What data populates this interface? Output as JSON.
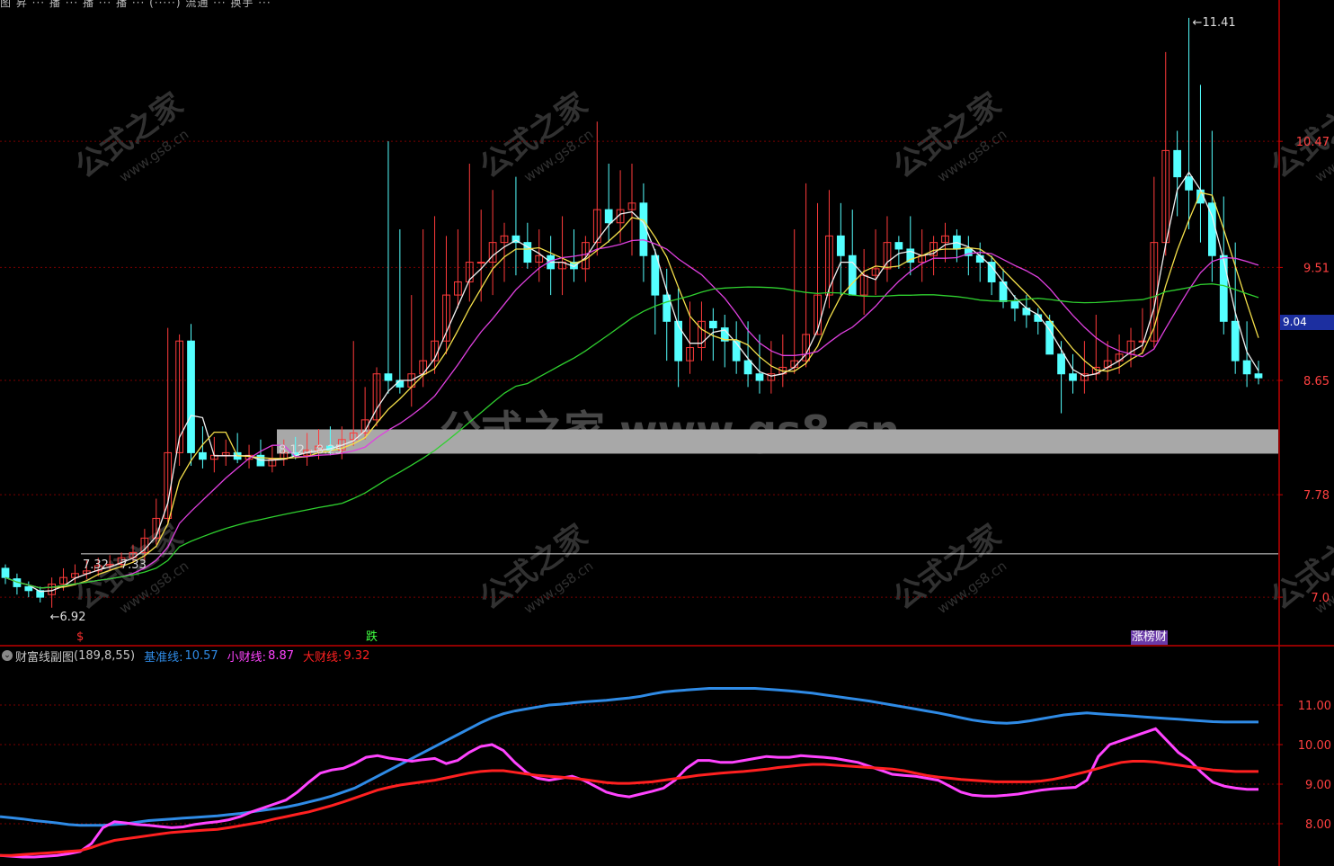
{
  "colors": {
    "background": "#000000",
    "up_candle": "#ff3b3b",
    "down_candle": "#54ffff",
    "ma_white": "#f0f0f0",
    "ma_yellow": "#f5e04a",
    "ma_magenta": "#e040e0",
    "ma_green": "#2fd02f",
    "grid": "#7a0000",
    "support_band": "#a8a8a8",
    "watermark": "#5a5a5a"
  },
  "watermarks": {
    "small": "公式之家",
    "small_url": "www.gs8.cn",
    "center": "公式之家 www.gs8.cn"
  },
  "price_panel": {
    "top_strip": "图 昇 ··· 播 ··· 播 ··· 播 ··· (·····) 流通 ··· 换手 ···",
    "y_axis_ticks": [
      "10.47",
      "9.51",
      "8.65",
      "7.78",
      "7.0"
    ],
    "current_price_tag": "9.04",
    "annotations": {
      "high": "11.41",
      "low": "6.92",
      "band_upper": "8.12 - 8.25",
      "band_lower": "7.32 - 7.33"
    },
    "signals": [
      {
        "text": "$",
        "color": "#ff3030"
      },
      {
        "text": "跌",
        "color": "#40ff40"
      },
      {
        "text": "涨榜财",
        "color": "#ffffff",
        "bg": "#6a3aa8"
      }
    ]
  },
  "indicator_panel": {
    "name": "财富线副图",
    "params": "(189,8,55)",
    "legend": [
      {
        "key": "基准线:",
        "value": "10.57",
        "color": "#2f8be6"
      },
      {
        "key": "小财线:",
        "value": "8.87",
        "color": "#ff44ff"
      },
      {
        "key": "大财线:",
        "value": "9.32",
        "color": "#ff2020"
      }
    ],
    "y_axis_ticks": [
      "11.00",
      "10.00",
      "9.00",
      "8.00"
    ]
  },
  "chart_data": [
    {
      "type": "candlestick",
      "ylim": [
        6.85,
        11.45
      ],
      "ohlc_open": [
        7.22,
        7.14,
        7.08,
        7.05,
        7.02,
        7.1,
        7.15,
        7.18,
        7.2,
        7.24,
        7.25,
        7.3,
        7.34,
        7.45,
        7.6,
        8.1,
        8.95,
        8.1,
        8.05,
        8.08,
        8.1,
        8.05,
        8.08,
        8.0,
        8.05,
        8.1,
        8.08,
        8.12,
        8.15,
        8.12,
        8.2,
        8.25,
        8.35,
        8.7,
        8.65,
        8.6,
        8.7,
        8.8,
        8.95,
        9.3,
        9.4,
        9.55,
        9.55,
        9.7,
        9.75,
        9.7,
        9.55,
        9.6,
        9.5,
        9.55,
        9.5,
        9.7,
        9.95,
        9.85,
        9.95,
        10.0,
        9.6,
        9.3,
        9.1,
        8.8,
        8.9,
        9.1,
        9.05,
        8.95,
        8.8,
        8.7,
        8.65,
        8.7,
        8.75,
        8.8,
        9.0,
        9.3,
        9.75,
        9.6,
        9.3,
        9.45,
        9.5,
        9.7,
        9.65,
        9.55,
        9.6,
        9.7,
        9.75,
        9.65,
        9.6,
        9.55,
        9.4,
        9.25,
        9.2,
        9.15,
        9.1,
        8.85,
        8.7,
        8.65,
        8.7,
        8.75,
        8.8,
        8.85,
        8.95,
        8.95,
        9.7,
        10.4,
        10.2,
        10.1,
        10.0,
        9.6,
        9.1,
        8.8,
        8.7
      ],
      "ohlc_high": [
        7.25,
        7.18,
        7.12,
        7.08,
        7.15,
        7.22,
        7.25,
        7.28,
        7.3,
        7.32,
        7.34,
        7.4,
        7.52,
        7.75,
        9.05,
        9.0,
        9.08,
        8.3,
        8.22,
        8.2,
        8.25,
        8.16,
        8.2,
        8.15,
        8.2,
        8.22,
        8.25,
        8.28,
        8.3,
        8.3,
        8.95,
        8.6,
        8.75,
        10.47,
        9.8,
        9.3,
        9.8,
        9.9,
        9.75,
        9.8,
        10.3,
        9.95,
        10.1,
        9.85,
        10.2,
        9.85,
        9.8,
        9.75,
        9.9,
        9.8,
        9.75,
        10.62,
        10.3,
        10.25,
        10.3,
        10.15,
        9.65,
        9.5,
        9.35,
        9.25,
        9.25,
        9.2,
        9.15,
        9.1,
        9.1,
        9.0,
        8.95,
        9.0,
        9.8,
        10.15,
        10.0,
        10.1,
        10.0,
        9.95,
        9.65,
        9.8,
        9.9,
        9.75,
        9.9,
        9.8,
        9.75,
        9.85,
        9.8,
        9.75,
        9.7,
        9.6,
        9.5,
        9.3,
        9.3,
        9.2,
        9.15,
        8.95,
        8.85,
        8.95,
        9.15,
        8.95,
        9.0,
        9.05,
        9.2,
        10.2,
        11.15,
        10.55,
        11.41,
        10.9,
        10.55,
        10.05,
        9.7,
        9.1,
        8.8
      ],
      "ohlc_low": [
        7.1,
        7.02,
        7.0,
        6.96,
        6.92,
        7.05,
        7.1,
        7.14,
        7.16,
        7.2,
        7.22,
        7.26,
        7.28,
        7.4,
        7.55,
        8.0,
        8.0,
        7.98,
        7.95,
        8.0,
        8.02,
        7.98,
        8.0,
        7.95,
        8.0,
        8.05,
        8.0,
        8.05,
        8.08,
        8.05,
        8.15,
        8.2,
        8.3,
        8.55,
        8.55,
        8.45,
        8.6,
        8.7,
        8.85,
        9.2,
        9.25,
        9.25,
        9.3,
        9.4,
        9.45,
        9.5,
        9.4,
        9.3,
        9.3,
        9.4,
        9.4,
        9.6,
        9.7,
        9.7,
        9.6,
        9.4,
        9.0,
        8.8,
        8.6,
        8.7,
        8.8,
        8.8,
        8.75,
        8.7,
        8.6,
        8.55,
        8.55,
        8.6,
        8.7,
        8.75,
        9.0,
        9.2,
        9.3,
        9.3,
        9.15,
        9.3,
        9.4,
        9.5,
        9.45,
        9.4,
        9.45,
        9.55,
        9.55,
        9.45,
        9.4,
        9.3,
        9.2,
        9.1,
        9.05,
        9.0,
        8.95,
        8.4,
        8.55,
        8.55,
        8.65,
        8.65,
        8.7,
        8.75,
        8.85,
        8.9,
        9.6,
        9.9,
        9.8,
        9.7,
        9.4,
        9.0,
        8.7,
        8.6,
        8.62
      ],
      "ohlc_close": [
        7.15,
        7.08,
        7.05,
        7.0,
        7.1,
        7.15,
        7.18,
        7.2,
        7.24,
        7.25,
        7.3,
        7.34,
        7.45,
        7.6,
        8.1,
        8.95,
        8.1,
        8.05,
        8.08,
        8.1,
        8.05,
        8.08,
        8.0,
        8.05,
        8.1,
        8.08,
        8.12,
        8.15,
        8.12,
        8.2,
        8.25,
        8.35,
        8.7,
        8.65,
        8.6,
        8.7,
        8.8,
        8.95,
        9.3,
        9.4,
        9.55,
        9.55,
        9.7,
        9.75,
        9.7,
        9.55,
        9.6,
        9.5,
        9.55,
        9.5,
        9.7,
        9.95,
        9.85,
        9.95,
        10.0,
        9.6,
        9.3,
        9.1,
        8.8,
        8.9,
        9.1,
        9.05,
        8.95,
        8.8,
        8.7,
        8.65,
        8.7,
        8.75,
        8.8,
        9.0,
        9.3,
        9.75,
        9.6,
        9.3,
        9.45,
        9.5,
        9.7,
        9.65,
        9.55,
        9.6,
        9.7,
        9.75,
        9.65,
        9.6,
        9.55,
        9.4,
        9.25,
        9.2,
        9.15,
        9.1,
        8.85,
        8.7,
        8.65,
        8.7,
        8.75,
        8.8,
        8.85,
        8.95,
        8.95,
        9.7,
        10.4,
        10.2,
        10.1,
        10.0,
        9.6,
        9.1,
        8.8,
        8.7,
        8.67
      ],
      "ma_series": [
        {
          "color": "#f0f0f0",
          "window": 3
        },
        {
          "color": "#f5e04a",
          "window": 5
        },
        {
          "color": "#e040e0",
          "window": 10
        },
        {
          "color": "#2fd02f",
          "window": 30
        }
      ],
      "support_bands": [
        {
          "lower": 8.12,
          "upper": 8.25
        },
        {
          "lower": 7.32,
          "upper": 7.33
        }
      ]
    },
    {
      "type": "line",
      "ylim": [
        7.0,
        12.0
      ],
      "x": [
        0,
        4,
        8,
        12,
        16,
        20,
        24,
        28,
        32,
        36,
        40,
        44,
        48,
        52,
        56,
        60,
        64,
        68,
        72,
        76,
        80,
        84,
        88,
        92,
        96,
        100,
        104,
        108,
        112,
        116,
        120,
        124,
        128,
        132,
        136,
        140,
        144,
        148,
        152,
        156,
        160,
        164,
        168,
        172,
        176,
        180,
        184,
        188,
        192,
        196,
        200,
        204,
        208,
        212,
        216,
        220,
        224,
        228,
        232,
        236,
        240,
        244,
        248,
        252,
        256,
        260,
        264,
        268,
        272,
        276,
        280,
        284,
        288,
        292,
        296,
        300,
        304,
        308,
        312,
        316,
        320,
        324,
        328,
        332,
        336,
        340,
        344,
        348,
        352,
        356,
        360,
        364,
        368,
        372,
        376,
        380,
        384,
        388,
        392,
        396,
        400,
        404,
        408,
        412,
        416,
        420,
        424,
        428,
        432,
        436,
        440
      ],
      "series": [
        {
          "name": "基准线",
          "color": "#2f8be6",
          "values": [
            8.18,
            8.15,
            8.12,
            8.08,
            8.05,
            8.02,
            7.98,
            7.96,
            7.96,
            7.96,
            7.98,
            8.0,
            8.04,
            8.08,
            8.1,
            8.12,
            8.14,
            8.16,
            8.18,
            8.2,
            8.23,
            8.26,
            8.3,
            8.34,
            8.38,
            8.42,
            8.48,
            8.55,
            8.62,
            8.7,
            8.8,
            8.9,
            9.05,
            9.2,
            9.35,
            9.5,
            9.65,
            9.8,
            9.95,
            10.1,
            10.25,
            10.4,
            10.55,
            10.68,
            10.78,
            10.85,
            10.9,
            10.95,
            11.0,
            11.02,
            11.05,
            11.08,
            11.1,
            11.12,
            11.15,
            11.18,
            11.22,
            11.28,
            11.33,
            11.36,
            11.38,
            11.4,
            11.42,
            11.42,
            11.42,
            11.42,
            11.42,
            11.4,
            11.38,
            11.36,
            11.33,
            11.3,
            11.26,
            11.22,
            11.18,
            11.14,
            11.1,
            11.05,
            11.0,
            10.95,
            10.9,
            10.85,
            10.8,
            10.74,
            10.68,
            10.62,
            10.58,
            10.55,
            10.54,
            10.56,
            10.6,
            10.65,
            10.7,
            10.75,
            10.78,
            10.8,
            10.78,
            10.76,
            10.74,
            10.72,
            10.7,
            10.68,
            10.66,
            10.64,
            10.62,
            10.6,
            10.58,
            10.57,
            10.57,
            10.57,
            10.57
          ]
        },
        {
          "name": "小财线",
          "color": "#ff44ff",
          "values": [
            7.2,
            7.18,
            7.16,
            7.16,
            7.18,
            7.2,
            7.24,
            7.3,
            7.5,
            7.9,
            8.05,
            8.02,
            7.98,
            7.96,
            7.93,
            7.9,
            7.92,
            7.98,
            8.02,
            8.05,
            8.1,
            8.18,
            8.3,
            8.4,
            8.5,
            8.6,
            8.8,
            9.05,
            9.28,
            9.36,
            9.4,
            9.52,
            9.68,
            9.72,
            9.66,
            9.62,
            9.58,
            9.62,
            9.65,
            9.52,
            9.6,
            9.8,
            9.95,
            10.0,
            9.85,
            9.55,
            9.3,
            9.15,
            9.1,
            9.15,
            9.2,
            9.1,
            8.95,
            8.8,
            8.72,
            8.68,
            8.75,
            8.82,
            8.9,
            9.1,
            9.4,
            9.6,
            9.6,
            9.55,
            9.55,
            9.6,
            9.65,
            9.7,
            9.68,
            9.68,
            9.72,
            9.7,
            9.68,
            9.65,
            9.6,
            9.55,
            9.45,
            9.35,
            9.25,
            9.22,
            9.2,
            9.15,
            9.1,
            8.95,
            8.8,
            8.72,
            8.7,
            8.7,
            8.72,
            8.75,
            8.8,
            8.85,
            8.88,
            8.9,
            8.92,
            9.1,
            9.7,
            10.0,
            10.1,
            10.2,
            10.3,
            10.4,
            10.1,
            9.8,
            9.6,
            9.3,
            9.05,
            8.95,
            8.9,
            8.87,
            8.87
          ]
        },
        {
          "name": "大财线",
          "color": "#ff2020",
          "values": [
            7.2,
            7.2,
            7.22,
            7.24,
            7.26,
            7.28,
            7.3,
            7.32,
            7.4,
            7.5,
            7.58,
            7.62,
            7.66,
            7.7,
            7.74,
            7.78,
            7.8,
            7.82,
            7.84,
            7.86,
            7.9,
            7.95,
            8.0,
            8.05,
            8.12,
            8.18,
            8.24,
            8.3,
            8.38,
            8.46,
            8.55,
            8.65,
            8.75,
            8.85,
            8.92,
            8.98,
            9.02,
            9.06,
            9.1,
            9.16,
            9.22,
            9.28,
            9.32,
            9.34,
            9.34,
            9.3,
            9.26,
            9.22,
            9.2,
            9.18,
            9.15,
            9.12,
            9.08,
            9.04,
            9.02,
            9.02,
            9.04,
            9.06,
            9.1,
            9.14,
            9.18,
            9.22,
            9.25,
            9.28,
            9.3,
            9.32,
            9.35,
            9.38,
            9.42,
            9.45,
            9.48,
            9.5,
            9.5,
            9.48,
            9.46,
            9.44,
            9.42,
            9.4,
            9.38,
            9.34,
            9.28,
            9.22,
            9.18,
            9.15,
            9.12,
            9.1,
            9.08,
            9.06,
            9.06,
            9.06,
            9.06,
            9.08,
            9.12,
            9.18,
            9.25,
            9.32,
            9.4,
            9.48,
            9.55,
            9.58,
            9.58,
            9.56,
            9.52,
            9.48,
            9.44,
            9.4,
            9.36,
            9.34,
            9.32,
            9.32,
            9.32
          ]
        }
      ]
    }
  ]
}
